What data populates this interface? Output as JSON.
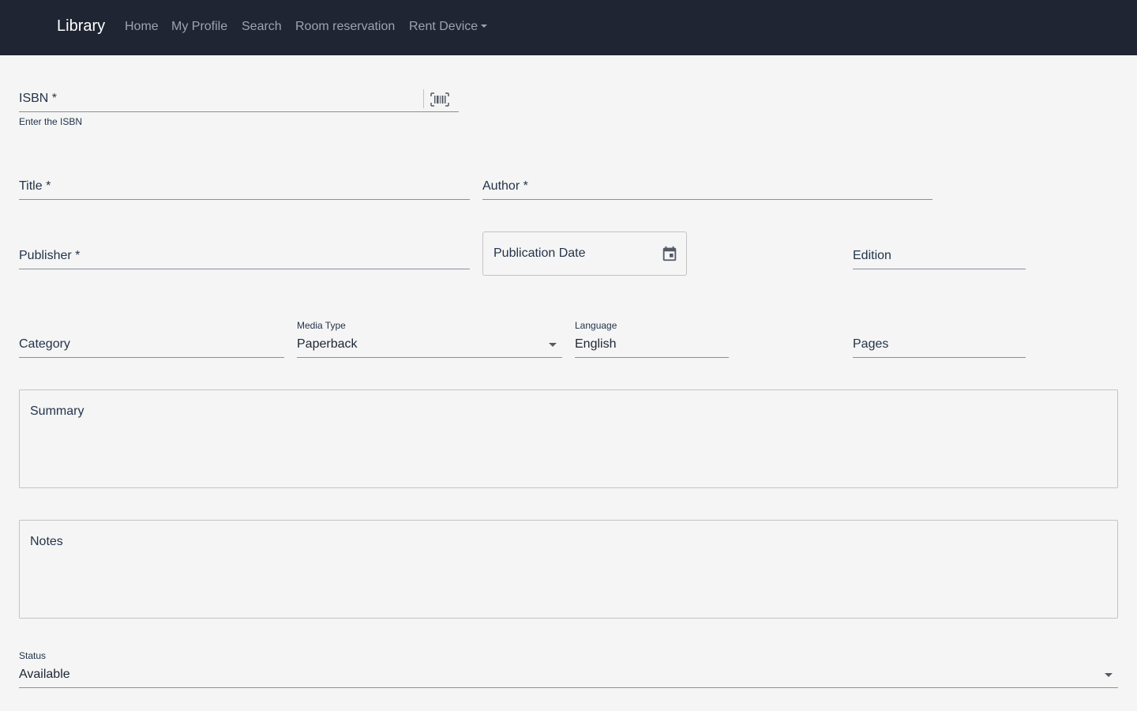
{
  "nav": {
    "brand": "Library",
    "links": [
      "Home",
      "My Profile",
      "Search",
      "Room reservation"
    ],
    "dropdown": "Rent Device"
  },
  "form": {
    "isbn": {
      "label": "ISBN *",
      "helper": "Enter the ISBN",
      "icon": "barcode-scan-icon"
    },
    "title": {
      "label": "Title *"
    },
    "author": {
      "label": "Author *"
    },
    "publisher": {
      "label": "Publisher *"
    },
    "publication_date": {
      "label": "Publication Date",
      "icon": "calendar-icon"
    },
    "edition": {
      "label": "Edition"
    },
    "category": {
      "label": "Category"
    },
    "media_type": {
      "label": "Media Type",
      "value": "Paperback"
    },
    "language": {
      "label": "Language",
      "value": "English"
    },
    "pages": {
      "label": "Pages"
    },
    "summary": {
      "label": "Summary"
    },
    "notes": {
      "label": "Notes"
    },
    "status": {
      "label": "Status",
      "value": "Available"
    }
  },
  "colors": {
    "navbar_bg": "#1f2532",
    "page_bg": "#f5f5f5",
    "nav_link": "#9ea4ad",
    "label": "#23344a"
  }
}
